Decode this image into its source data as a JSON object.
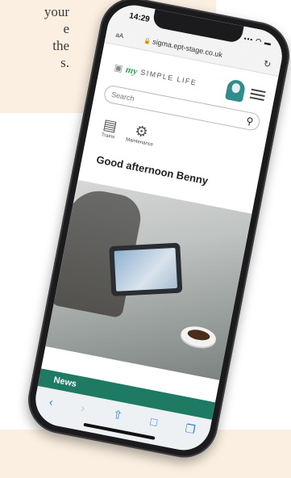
{
  "background_text": {
    "lines": [
      "your",
      "e",
      "the",
      "s."
    ]
  },
  "status_bar": {
    "time": "14:29",
    "icons": "▪▪▪ ◠ ▬"
  },
  "browser": {
    "text_size_label": "aA",
    "url": "sigma.ept-stage.co.uk",
    "reload_icon": "reload-icon"
  },
  "site": {
    "logo_my": "my",
    "logo_text": "SIMPLE LIFE",
    "search_placeholder": "Search",
    "tiles": [
      {
        "label": "Trains",
        "icon": "train-icon"
      },
      {
        "label": "Maintenance",
        "icon": "maintenance-icon"
      }
    ],
    "greeting": "Good afternoon Benny",
    "news_label": "News"
  },
  "colors": {
    "accent_green": "#1e7a63",
    "logo_green": "#3aa35a",
    "avatar_teal": "#2f8c8a",
    "toolbar_blue": "#2f7fe0",
    "panel_beige": "#fbefe1"
  }
}
